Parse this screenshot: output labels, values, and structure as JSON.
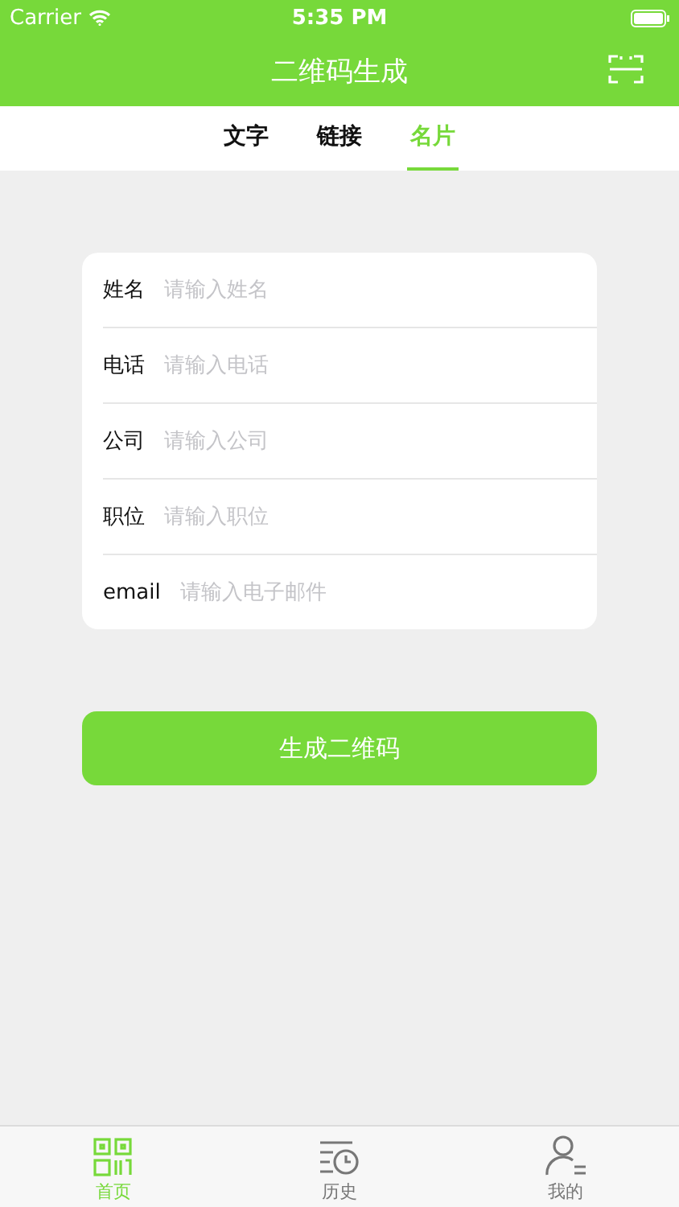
{
  "status_bar": {
    "carrier": "Carrier",
    "time": "5:35 PM"
  },
  "nav_bar": {
    "title": "二维码生成"
  },
  "tabs": [
    {
      "label": "文字",
      "selected": false
    },
    {
      "label": "链接",
      "selected": false
    },
    {
      "label": "名片",
      "selected": true
    }
  ],
  "form": [
    {
      "label": "姓名",
      "placeholder": "请输入姓名"
    },
    {
      "label": "电话",
      "placeholder": "请输入电话"
    },
    {
      "label": "公司",
      "placeholder": "请输入公司"
    },
    {
      "label": "职位",
      "placeholder": "请输入职位"
    },
    {
      "label": "email",
      "placeholder": "请输入电子邮件"
    }
  ],
  "submit_button": "生成二维码",
  "tab_bar": [
    {
      "label": "首页",
      "kind": "qr",
      "selected": true
    },
    {
      "label": "历史",
      "kind": "history",
      "selected": false
    },
    {
      "label": "我的",
      "kind": "profile",
      "selected": false
    }
  ]
}
